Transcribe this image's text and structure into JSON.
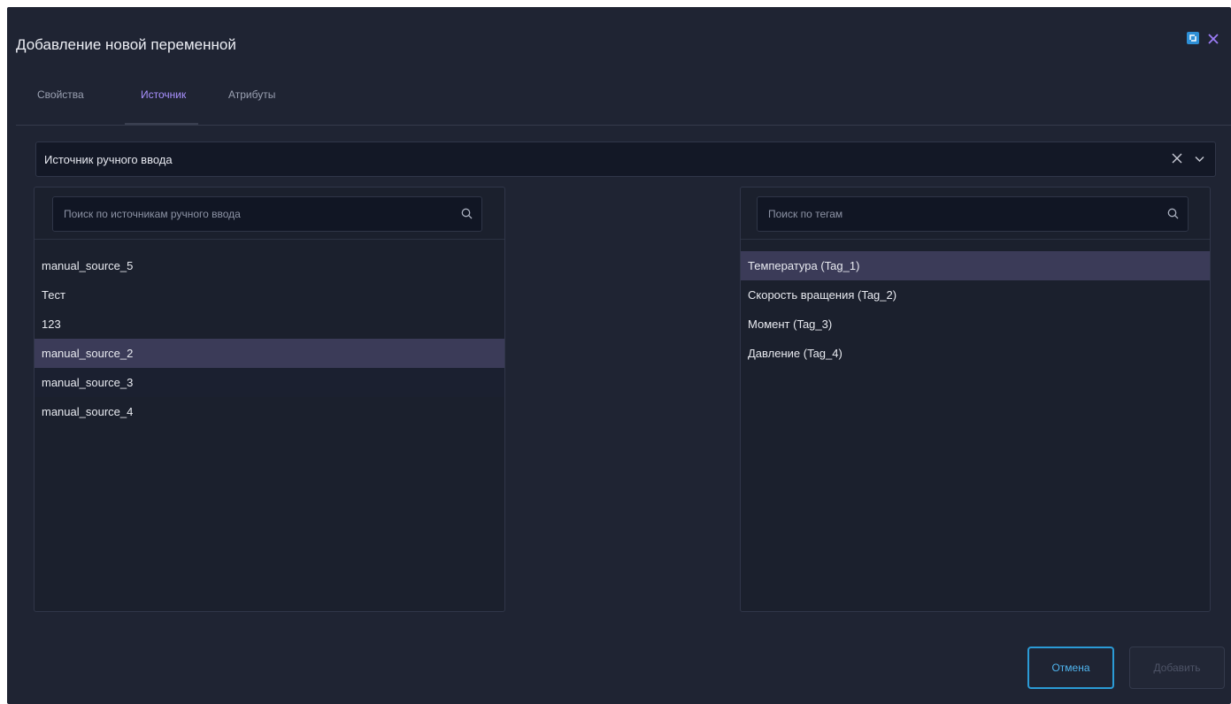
{
  "dialog": {
    "title": "Добавление новой переменной"
  },
  "tabs": [
    {
      "label": "Свойства",
      "active": false
    },
    {
      "label": "Источник",
      "active": true
    },
    {
      "label": "Атрибуты",
      "active": false
    }
  ],
  "source_select": {
    "value": "Источник ручного ввода"
  },
  "left_panel": {
    "search_placeholder": "Поиск по источникам ручного ввода",
    "items": [
      {
        "label": "manual_source_5"
      },
      {
        "label": "Тест"
      },
      {
        "label": "123"
      },
      {
        "label": "manual_source_2",
        "selected": true
      },
      {
        "label": "manual_source_3"
      },
      {
        "label": "manual_source_4"
      }
    ]
  },
  "right_panel": {
    "search_placeholder": "Поиск по тегам",
    "items": [
      {
        "label": "Температура (Tag_1)",
        "selected": true
      },
      {
        "label": "Скорость вращения (Tag_2)"
      },
      {
        "label": "Момент (Tag_3)"
      },
      {
        "label": "Давление (Tag_4)"
      }
    ]
  },
  "footer": {
    "cancel_label": "Отмена",
    "add_label": "Добавить"
  },
  "colors": {
    "background": "#1f2433",
    "accent": "#a991ff",
    "selection": "#3b3b58",
    "cancel_border": "#2b9bd6"
  },
  "icons": {
    "expand": "expand-icon",
    "close": "close-icon",
    "clear": "clear-icon",
    "dropdown": "chevron-down-icon",
    "search": "search-icon"
  }
}
